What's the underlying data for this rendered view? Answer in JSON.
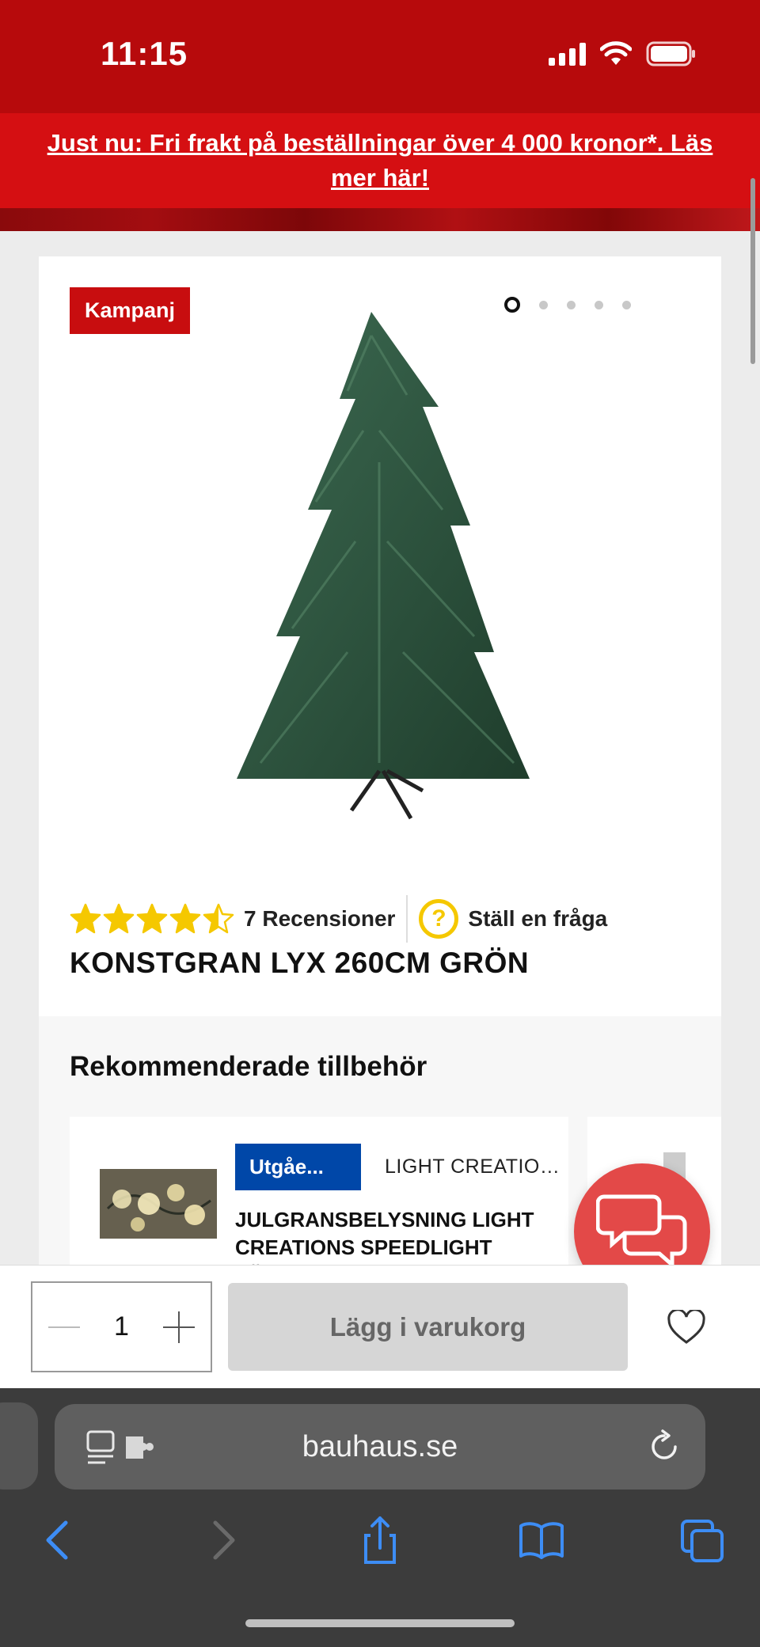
{
  "status_bar": {
    "time": "11:15"
  },
  "promo": {
    "text": "Just nu: Fri frakt på beställningar över 4 000 kronor*. Läs mer här!"
  },
  "product": {
    "badge": "Kampanj",
    "image_count": 5,
    "active_image": 1,
    "rating": 4.5,
    "reviews_label": "7 Recensioner",
    "question_icon": "?",
    "ask_label": "Ställ en fråga",
    "title": "KONSTGRAN LYX 260CM GRÖN"
  },
  "recommended": {
    "title": "Rekommenderade tillbehör",
    "items": [
      {
        "tag": "Utgåe...",
        "brand": "LIGHT CREATIONS",
        "name": "JULGRANSBELYSNING LIGHT CREATIONS SPEEDLIGHT FÖR..."
      }
    ]
  },
  "cart": {
    "quantity": "1",
    "add_label": "Lägg i varukorg"
  },
  "browser": {
    "url": "bauhaus.se"
  },
  "colors": {
    "brand_red": "#d50f12",
    "tag_blue": "#0047a8",
    "star_yellow": "#f5c800",
    "chat_red": "#e34948",
    "ios_blue": "#3d8df5"
  }
}
